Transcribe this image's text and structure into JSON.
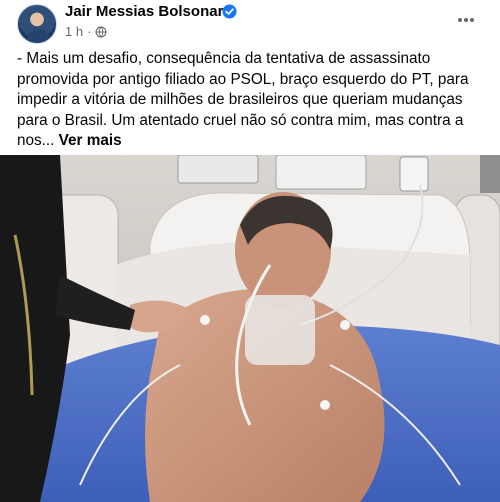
{
  "post": {
    "author": "Jair Messias Bolsonaro",
    "time": "1 h",
    "separator": "·",
    "text": "- Mais um desafio, consequência da tentativa de assassinato\npromovida por antigo filiado ao PSOL, braço esquerdo do PT, para\nimpedir a vitória de milhões de brasileiros que queriam mudanças\npara o Brasil. Um atentado cruel não só contra mim, mas contra a\nnos...",
    "see_more": "Ver mais"
  },
  "icons": {
    "verified": "verified-badge-icon",
    "privacy": "globe-icon",
    "menu": "more-options-icon"
  },
  "colors": {
    "verified_blue": "#1877f2",
    "secondary_text": "#65676b"
  }
}
